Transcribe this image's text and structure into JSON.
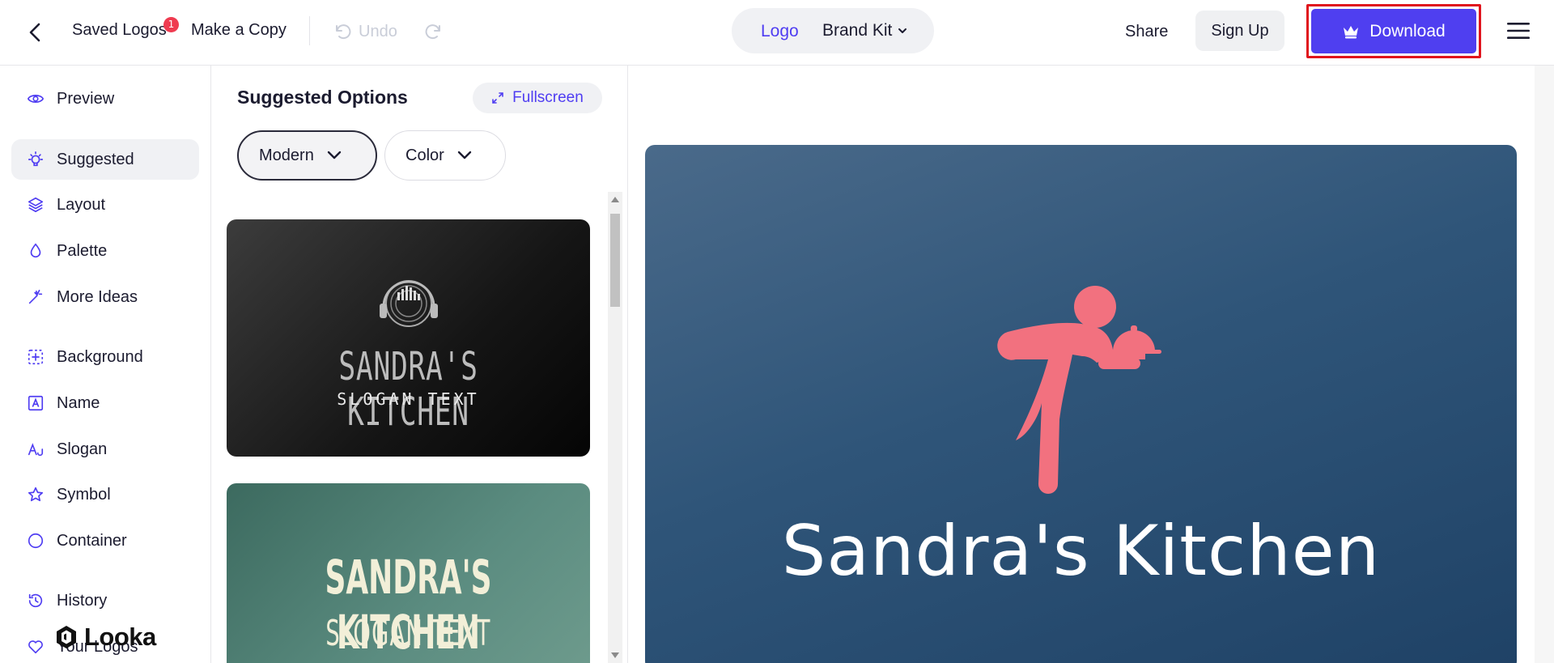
{
  "topbar": {
    "back_icon": "chevron-left-icon",
    "saved_logos_label": "Saved Logos",
    "saved_logos_badge": "1",
    "make_copy_label": "Make a Copy",
    "undo_label": "Undo",
    "undo_icon": "undo-icon",
    "redo_icon": "redo-icon",
    "tab_logo_label": "Logo",
    "tab_brand_kit_label": "Brand Kit",
    "share_label": "Share",
    "sign_up_label": "Sign Up",
    "download_label": "Download",
    "download_icon": "crown-icon",
    "menu_icon": "hamburger-icon"
  },
  "sidebar": {
    "items": [
      {
        "label": "Preview",
        "icon": "eye-icon"
      },
      {
        "label": "Suggested",
        "icon": "lightbulb-icon",
        "active": true
      },
      {
        "label": "Layout",
        "icon": "layers-icon"
      },
      {
        "label": "Palette",
        "icon": "droplet-icon"
      },
      {
        "label": "More Ideas",
        "icon": "magic-wand-icon"
      },
      {
        "label": "Background",
        "icon": "background-grid-icon"
      },
      {
        "label": "Name",
        "icon": "text-box-icon"
      },
      {
        "label": "Slogan",
        "icon": "slogan-text-icon"
      },
      {
        "label": "Symbol",
        "icon": "star-icon"
      },
      {
        "label": "Container",
        "icon": "circle-icon"
      },
      {
        "label": "History",
        "icon": "history-icon"
      },
      {
        "label": "Your Logos",
        "icon": "heart-icon"
      }
    ],
    "brand": "Looka"
  },
  "panel": {
    "title": "Suggested Options",
    "fullscreen_label": "Fullscreen",
    "filters": [
      {
        "label": "Modern",
        "selected": true
      },
      {
        "label": "Color",
        "selected": false
      }
    ],
    "cards": [
      {
        "name": "SANDRA'S KITCHEN",
        "slogan": "SLOGAN TEXT"
      },
      {
        "name": "SANDRA'S KITCHEN",
        "slogan": "SLOGAN TEXT"
      }
    ]
  },
  "preview": {
    "logo_name": "Sandra's Kitchen"
  },
  "colors": {
    "accent": "#4f3df2",
    "download_bg": "#4f3ff0",
    "highlight_border": "#e0141d",
    "badge": "#ef3b50",
    "logo_symbol": "#f2717f",
    "logo_bg": "#2f5579"
  }
}
